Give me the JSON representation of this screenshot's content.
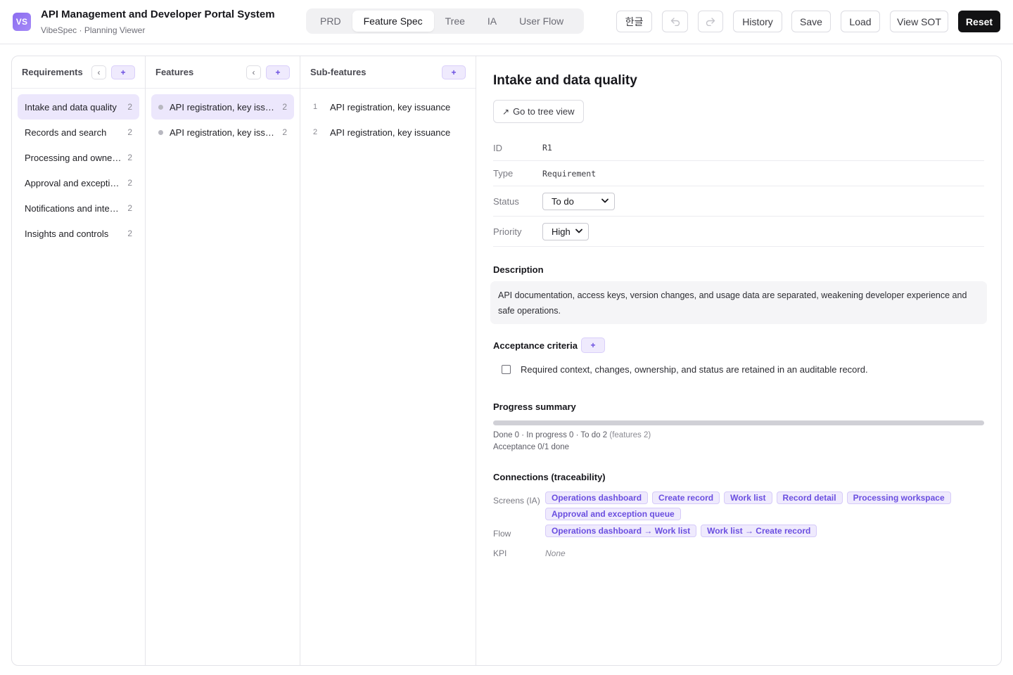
{
  "header": {
    "logo": "VS",
    "title": "API Management and Developer Portal System",
    "subtitle": "VibeSpec · Planning Viewer",
    "tabs": [
      {
        "label": "PRD",
        "active": false
      },
      {
        "label": "Feature Spec",
        "active": true
      },
      {
        "label": "Tree",
        "active": false
      },
      {
        "label": "IA",
        "active": false
      },
      {
        "label": "User Flow",
        "active": false
      }
    ],
    "lang": "한글",
    "undo_icon": "undo-icon",
    "redo_icon": "redo-icon",
    "history": "History",
    "save": "Save",
    "load": "Load",
    "view_sot": "View SOT",
    "reset": "Reset"
  },
  "requirements": {
    "title": "Requirements",
    "back": "‹",
    "add": "+",
    "items": [
      {
        "label": "Intake and data quality",
        "count": "2",
        "selected": true
      },
      {
        "label": "Records and search",
        "count": "2",
        "selected": false
      },
      {
        "label": "Processing and ownership",
        "count": "2",
        "selected": false
      },
      {
        "label": "Approval and exceptions",
        "count": "2",
        "selected": false
      },
      {
        "label": "Notifications and integrations",
        "count": "2",
        "selected": false
      },
      {
        "label": "Insights and controls",
        "count": "2",
        "selected": false
      }
    ]
  },
  "features": {
    "title": "Features",
    "back": "‹",
    "add": "+",
    "items": [
      {
        "label": "API registration, key issuance",
        "count": "2",
        "selected": true
      },
      {
        "label": "API registration, key issuance",
        "count": "2",
        "selected": false
      }
    ]
  },
  "subfeatures": {
    "title": "Sub-features",
    "add": "+",
    "items": [
      {
        "num": "1",
        "label": "API registration, key issuance"
      },
      {
        "num": "2",
        "label": "API registration, key issuance"
      }
    ]
  },
  "detail": {
    "title": "Intake and data quality",
    "goto": "Go to tree view",
    "goto_icon": "↗",
    "id_label": "ID",
    "id_value": "R1",
    "type_label": "Type",
    "type_value": "Requirement",
    "status_label": "Status",
    "status_value": "To do",
    "priority_label": "Priority",
    "priority_value": "High",
    "description_label": "Description",
    "description": "API documentation, access keys, version changes, and usage data are separated, weakening developer experience and safe operations.",
    "acceptance_label": "Acceptance criteria",
    "acceptance_add": "+",
    "acceptance_items": [
      {
        "text": "Required context, changes, ownership, and status are retained in an auditable record.",
        "checked": false
      }
    ],
    "progress_label": "Progress summary",
    "progress_done_fraction": 0,
    "progress_line": "Done 0 · In progress 0 · To do 2",
    "progress_features": "(features 2)",
    "acceptance_line": "Acceptance 0/1 done",
    "connections_label": "Connections (traceability)",
    "screens_label": "Screens (IA)",
    "screens": [
      "Operations dashboard",
      "Create record",
      "Work list",
      "Record detail",
      "Processing workspace",
      "Approval and exception queue"
    ],
    "flow_label": "Flow",
    "flows": [
      "Operations dashboard → Work list",
      "Work list → Create record"
    ],
    "kpi_label": "KPI",
    "kpi_value": "None"
  },
  "colors": {
    "accent": "#7a5cf0",
    "accent_bg": "#efeafd",
    "selected_row": "#ece7fc",
    "dark_button": "#121214"
  }
}
